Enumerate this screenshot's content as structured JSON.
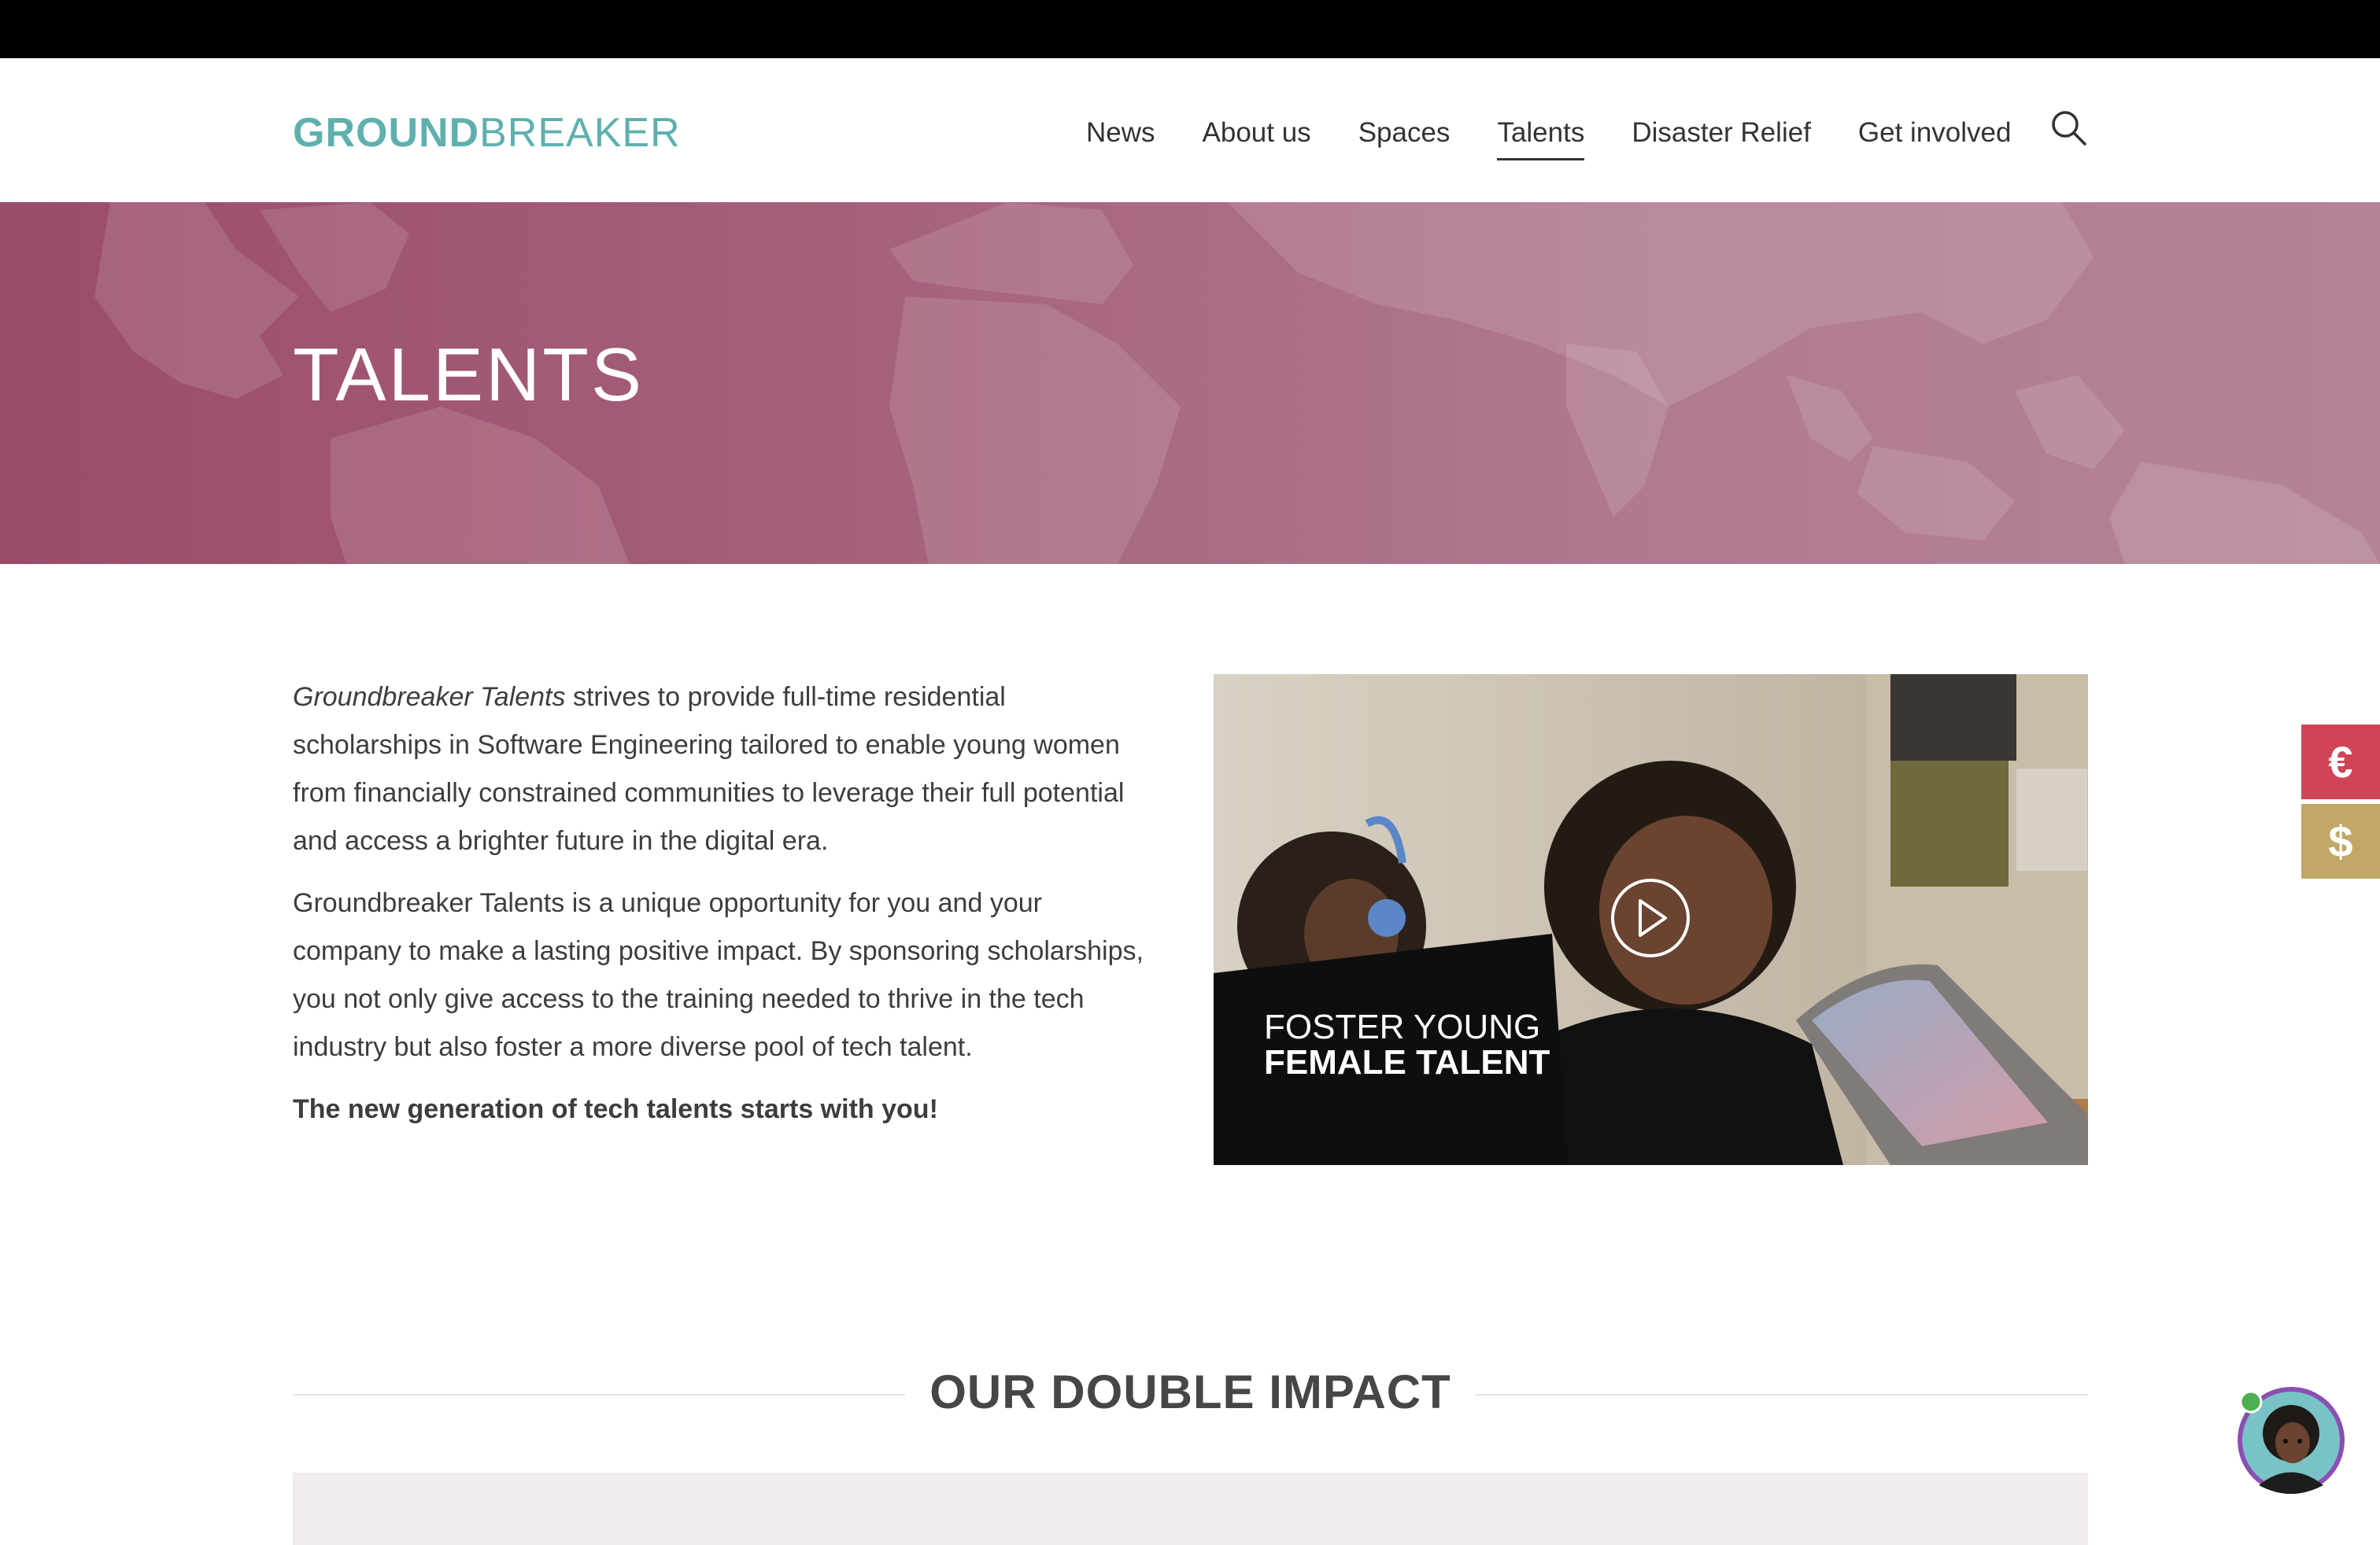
{
  "brand": {
    "bold": "GROUND",
    "light": "BREAKER"
  },
  "nav": {
    "items": [
      {
        "label": "News"
      },
      {
        "label": "About us"
      },
      {
        "label": "Spaces"
      },
      {
        "label": "Talents"
      },
      {
        "label": "Disaster Relief"
      },
      {
        "label": "Get involved"
      }
    ],
    "active": "Talents"
  },
  "hero": {
    "title": "TALENTS"
  },
  "intro": {
    "p1_em": "Groundbreaker Talents",
    "p1_rest": " strives to provide full-time residential scholarships in Software Engineering tailored to enable young women from financially constrained communities to leverage their full potential and access a brighter future in the digital era.",
    "p2": "Groundbreaker Talents is a unique opportunity for you and your company to make a lasting positive impact. By sponsoring scholarships, you not only give access to the training needed to thrive in the tech industry but also foster a more diverse pool of tech talent.",
    "p3": "The new generation of tech talents starts with you!"
  },
  "video": {
    "caption_line1": "FOSTER YOUNG",
    "caption_line2": "FEMALE TALENT"
  },
  "currency": {
    "eur": "€",
    "usd": "$"
  },
  "impact": {
    "title": "OUR DOUBLE IMPACT"
  },
  "colors": {
    "brand_teal": "#5fb0ad",
    "hero_magenta": "#9a4c6b",
    "euro_red": "#d14456",
    "dollar_gold": "#c1a868"
  },
  "icons": [
    "search-icon",
    "play-icon",
    "chat-avatar-icon",
    "online-status-dot"
  ]
}
